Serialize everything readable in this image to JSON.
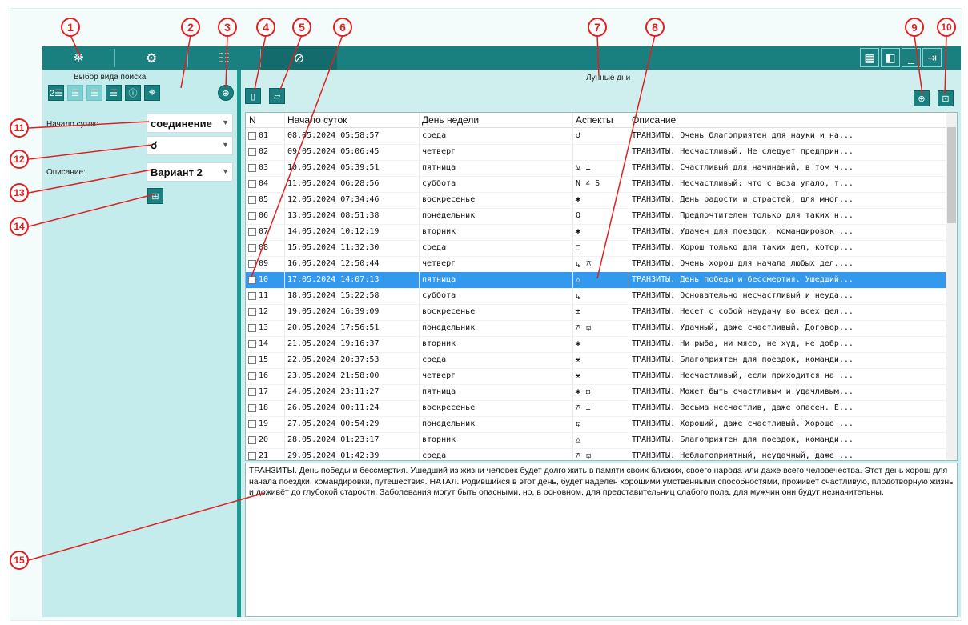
{
  "toolbar": {
    "tabs": [
      {
        "name": "binoculars",
        "icon": "⛯"
      },
      {
        "name": "settings",
        "icon": "⚙"
      },
      {
        "name": "document",
        "icon": "☷"
      },
      {
        "name": "link",
        "icon": "⊘"
      }
    ],
    "window_buttons": [
      {
        "name": "grid-view",
        "icon": "▦"
      },
      {
        "name": "panel-view",
        "icon": "◧"
      },
      {
        "name": "minimize",
        "icon": "_"
      },
      {
        "name": "exit",
        "icon": "⇥"
      }
    ]
  },
  "left": {
    "search_type_label": "Выбор вида поиска",
    "day_start_label": "Начало суток:",
    "day_start_value": "соединение",
    "symbol_value": "☌",
    "description_label": "Описание:",
    "description_value": "Вариант 2",
    "mode_buttons": [
      {
        "label": "2☰"
      },
      {
        "label": "☰"
      },
      {
        "label": "☰"
      },
      {
        "label": "☰"
      },
      {
        "label": "ⓘ"
      },
      {
        "label": "⛯"
      }
    ]
  },
  "main": {
    "title": "Лунные дни",
    "columns": [
      "N",
      "Начало суток",
      "День недели",
      "Аспекты",
      "Описание"
    ],
    "rows": [
      {
        "n": "01",
        "start": "08.05.2024 05:58:57",
        "day": "среда",
        "aspects": "☌",
        "desc": "ТРАНЗИТЫ. Очень благоприятен для науки и на..."
      },
      {
        "n": "02",
        "start": "09.05.2024 05:06:45",
        "day": "четверг",
        "aspects": "",
        "desc": "ТРАНЗИТЫ. Несчастливый. Не следует предприн..."
      },
      {
        "n": "03",
        "start": "10.05.2024 05:39:51",
        "day": "пятница",
        "aspects": "⚺ ⊥",
        "desc": "ТРАНЗИТЫ. Счастливый для начинаний, в том ч..."
      },
      {
        "n": "04",
        "start": "11.05.2024 06:28:56",
        "day": "суббота",
        "aspects": "N ∠ S",
        "desc": "ТРАНЗИТЫ. Несчастливый: что с воза упало, т..."
      },
      {
        "n": "05",
        "start": "12.05.2024 07:34:46",
        "day": "воскресенье",
        "aspects": "✱",
        "desc": "ТРАНЗИТЫ. День радости и страстей, для мног..."
      },
      {
        "n": "06",
        "start": "13.05.2024 08:51:38",
        "day": "понедельник",
        "aspects": "Q",
        "desc": "ТРАНЗИТЫ. Предпочтителен только для таких н..."
      },
      {
        "n": "07",
        "start": "14.05.2024 10:12:19",
        "day": "вторник",
        "aspects": "✱",
        "desc": "ТРАНЗИТЫ. Удачен для поездок, командировок ..."
      },
      {
        "n": "08",
        "start": "15.05.2024 11:32:30",
        "day": "среда",
        "aspects": "□",
        "desc": "ТРАНЗИТЫ. Хорош только для таких дел, котор..."
      },
      {
        "n": "09",
        "start": "16.05.2024 12:50:44",
        "day": "четверг",
        "aspects": "⚼ ⚻",
        "desc": "ТРАНЗИТЫ. Очень хорош для начала любых дел...."
      },
      {
        "n": "10",
        "start": "17.05.2024 14:07:13",
        "day": "пятница",
        "aspects": "△",
        "desc": "ТРАНЗИТЫ. День победы и бессмертия. Ушедший...",
        "selected": true
      },
      {
        "n": "11",
        "start": "18.05.2024 15:22:58",
        "day": "суббота",
        "aspects": "⚼",
        "desc": "ТРАНЗИТЫ. Основательно несчастливый и неуда..."
      },
      {
        "n": "12",
        "start": "19.05.2024 16:39:09",
        "day": "воскресенье",
        "aspects": "±",
        "desc": "ТРАНЗИТЫ. Несет с собой неудачу во всех дел..."
      },
      {
        "n": "13",
        "start": "20.05.2024 17:56:51",
        "day": "понедельник",
        "aspects": "⚻ ⚼",
        "desc": "ТРАНЗИТЫ. Удачный, даже счастливый. Договор..."
      },
      {
        "n": "14",
        "start": "21.05.2024 19:16:37",
        "day": "вторник",
        "aspects": "✱",
        "desc": "ТРАНЗИТЫ. Ни рыба, ни мясо, не худ, не добр..."
      },
      {
        "n": "15",
        "start": "22.05.2024 20:37:53",
        "day": "среда",
        "aspects": "⚹",
        "desc": "ТРАНЗИТЫ. Благоприятен для поездок, команди..."
      },
      {
        "n": "16",
        "start": "23.05.2024 21:58:00",
        "day": "четверг",
        "aspects": "⚹",
        "desc": "ТРАНЗИТЫ. Несчастливый, если приходится на ..."
      },
      {
        "n": "17",
        "start": "24.05.2024 23:11:27",
        "day": "пятница",
        "aspects": "✱ ⚼",
        "desc": "ТРАНЗИТЫ. Может быть счастливым и удачливым..."
      },
      {
        "n": "18",
        "start": "26.05.2024 00:11:24",
        "day": "воскресенье",
        "aspects": "⚻ ±",
        "desc": "ТРАНЗИТЫ. Весьма несчастлив, даже опасен. Е..."
      },
      {
        "n": "19",
        "start": "27.05.2024 00:54:29",
        "day": "понедельник",
        "aspects": "⚼",
        "desc": "ТРАНЗИТЫ. Хороший, даже счастливый. Хорошо ..."
      },
      {
        "n": "20",
        "start": "28.05.2024 01:23:17",
        "day": "вторник",
        "aspects": "△",
        "desc": "ТРАНЗИТЫ. Благоприятен для поездок, команди..."
      },
      {
        "n": "21",
        "start": "29.05.2024 01:42:39",
        "day": "среда",
        "aspects": "⚻ ⚼",
        "desc": "ТРАНЗИТЫ. Неблагоприятный, неудачный, даже ..."
      }
    ],
    "description_text": "ТРАНЗИТЫ. День победы и бессмертия. Ушедший из жизни человек будет долго жить в памяти своих близких, своего народа или даже всего человечества. Этот день хорош для начала поездки, командировки, путешествия. НАТАЛ. Родившийся в этот день, будет наделён хорошими умственными способностями, проживёт счастливую, плодотворную жизнь и доживёт до глубокой старости. Заболевания могут быть опасными, но, в основном, для представительниц слабого пола, для мужчин они будут незначительны."
  },
  "callouts": [
    "1",
    "2",
    "3",
    "4",
    "5",
    "6",
    "7",
    "8",
    "9",
    "10",
    "11",
    "12",
    "13",
    "14",
    "15"
  ],
  "colors": {
    "accent": "#1a7f7f",
    "panel": "#c5ecec",
    "selection": "#3399ee",
    "callout": "#e02020"
  }
}
